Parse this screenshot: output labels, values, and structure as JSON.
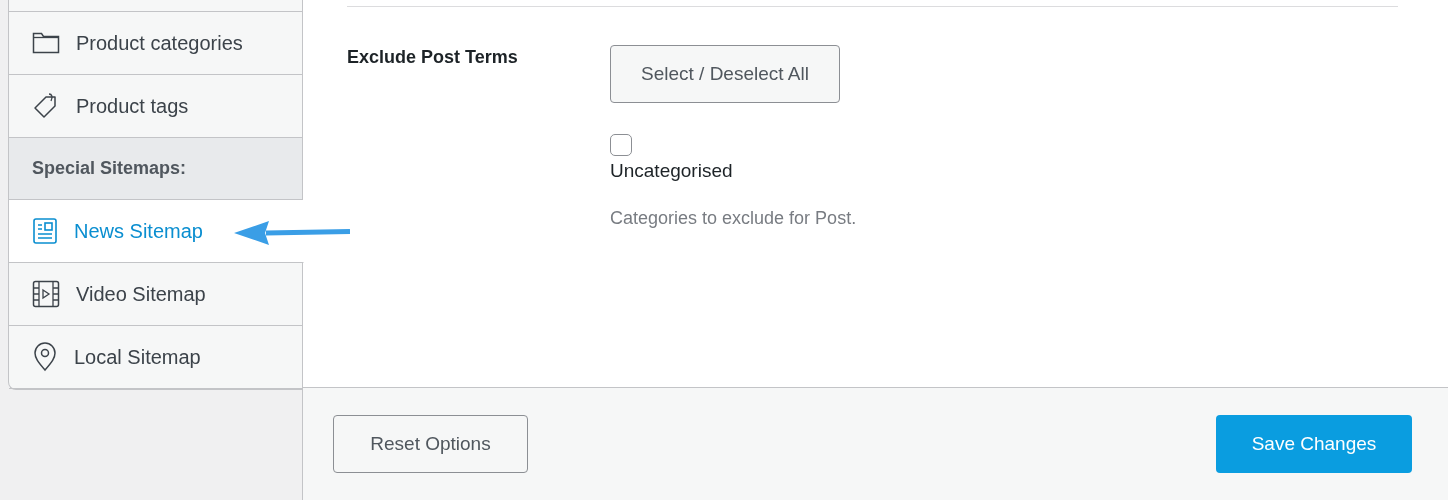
{
  "sidebar": {
    "items": [
      {
        "kind": "item",
        "label": "Product categories",
        "selected": false
      },
      {
        "kind": "item",
        "label": "Product tags",
        "selected": false
      },
      {
        "kind": "heading",
        "label": "Special Sitemaps:"
      },
      {
        "kind": "item",
        "label": "News Sitemap",
        "selected": true
      },
      {
        "kind": "item",
        "label": "Video Sitemap",
        "selected": false
      },
      {
        "kind": "item",
        "label": "Local Sitemap",
        "selected": false
      }
    ]
  },
  "setting": {
    "label": "Exclude Post Terms",
    "button": "Select / Deselect All",
    "options": [
      {
        "label": "Uncategorised",
        "checked": false
      }
    ],
    "help": "Categories to exclude for Post."
  },
  "footer": {
    "reset": "Reset Options",
    "save": "Save Changes"
  }
}
